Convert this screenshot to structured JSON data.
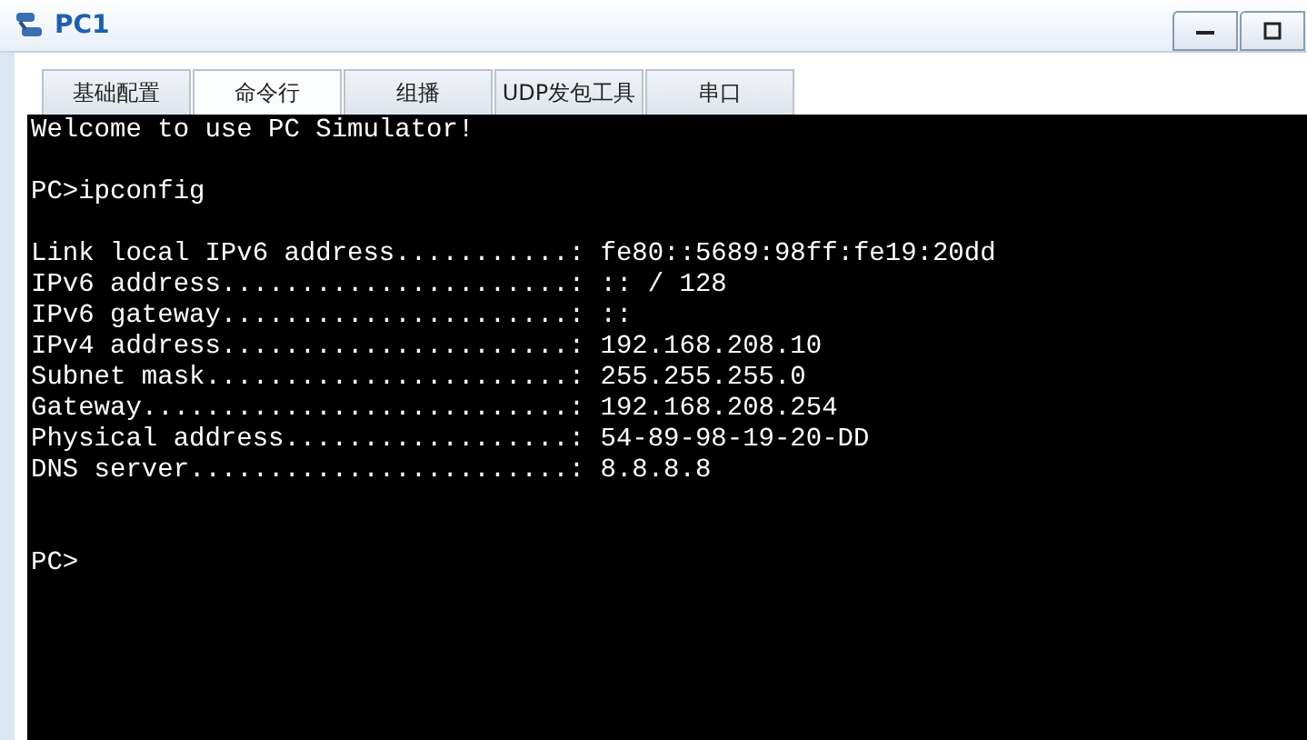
{
  "window": {
    "title": "PC1"
  },
  "tabs": [
    {
      "label": "基础配置",
      "selected": false
    },
    {
      "label": "命令行",
      "selected": true
    },
    {
      "label": "组播",
      "selected": false
    },
    {
      "label": "UDP发包工具",
      "selected": false
    },
    {
      "label": "串口",
      "selected": false
    }
  ],
  "terminal": {
    "lines": [
      {
        "kind": "text",
        "text": "Welcome to use PC Simulator!"
      },
      {
        "kind": "blank"
      },
      {
        "kind": "text",
        "text": "PC>ipconfig"
      },
      {
        "kind": "blank"
      },
      {
        "kind": "text",
        "text": "Link local IPv6 address...........: fe80::5689:98ff:fe19:20dd"
      },
      {
        "kind": "text",
        "text": "IPv6 address......................: :: / 128"
      },
      {
        "kind": "text",
        "text": "IPv6 gateway......................: ::"
      },
      {
        "kind": "text",
        "text": "IPv4 address......................: 192.168.208.10"
      },
      {
        "kind": "text",
        "text": "Subnet mask.......................: 255.255.255.0"
      },
      {
        "kind": "text",
        "text": "Gateway...........................: 192.168.208.254"
      },
      {
        "kind": "text",
        "text": "Physical address..................: 54-89-98-19-20-DD"
      },
      {
        "kind": "text",
        "text": "DNS server........................: 8.8.8.8"
      },
      {
        "kind": "blank"
      },
      {
        "kind": "blank"
      },
      {
        "kind": "text",
        "text": "PC>"
      }
    ]
  }
}
